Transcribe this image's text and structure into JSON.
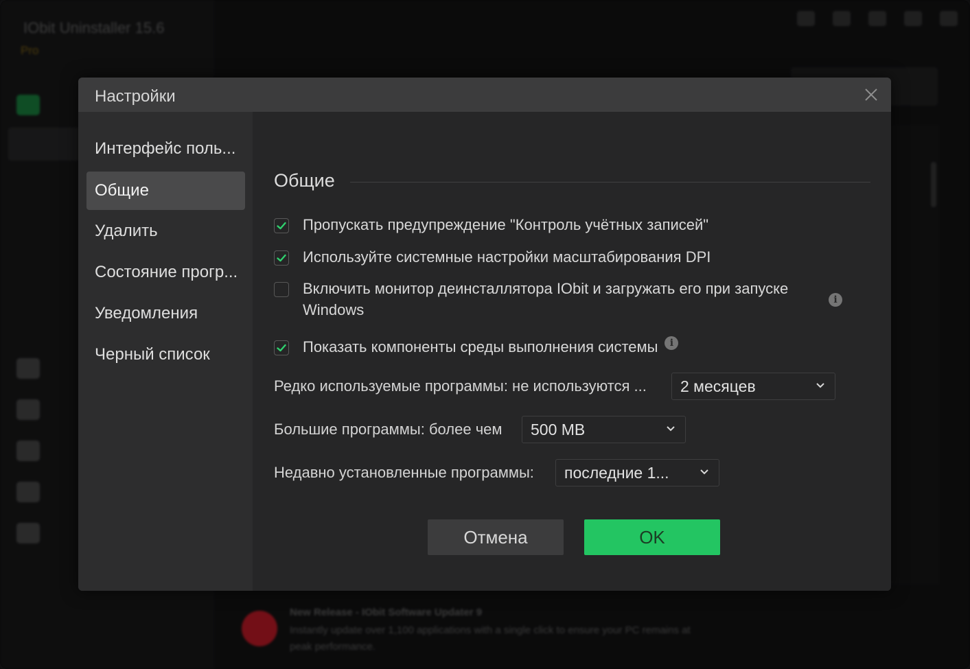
{
  "background_app": {
    "title": "IObit Uninstaller 15.6",
    "edition": "Pro",
    "news": {
      "title": "New Release - IObit Software Updater 9",
      "body": "Instantly update over 1,100 applications with a single click to ensure your PC remains at",
      "body2": "peak performance."
    }
  },
  "dialog": {
    "title": "Настройки",
    "nav": [
      {
        "label": "Интерфейс поль..."
      },
      {
        "label": "Общие"
      },
      {
        "label": "Удалить"
      },
      {
        "label": "Состояние прогр..."
      },
      {
        "label": "Уведомления"
      },
      {
        "label": "Черный список"
      }
    ],
    "active_nav": "Общие",
    "section_title": "Общие",
    "options": [
      {
        "label": "Пропускать предупреждение \"Контроль учётных записей\"",
        "checked": true
      },
      {
        "label": "Используйте системные настройки масштабирования DPI",
        "checked": true
      },
      {
        "label": "Включить монитор деинсталлятора IObit и загружать его при запуске Windows",
        "checked": false,
        "info": true
      },
      {
        "label": "Показать компоненты среды выполнения системы",
        "checked": true,
        "info": true
      }
    ],
    "fields": {
      "rarely_used": {
        "label": "Редко используемые программы: не используются ...",
        "value": "2 месяцев"
      },
      "large_programs": {
        "label": "Большие программы: более чем",
        "value": "500 MB"
      },
      "recently_installed": {
        "label": "Недавно установленные программы:",
        "value": "последние 1..."
      }
    },
    "buttons": {
      "cancel": "Отмена",
      "ok": "OK"
    }
  },
  "colors": {
    "accent_green": "#23c562",
    "checkmark_green": "#2fd16e",
    "dialog_bg": "#2d2d2e",
    "content_bg": "#262627"
  }
}
